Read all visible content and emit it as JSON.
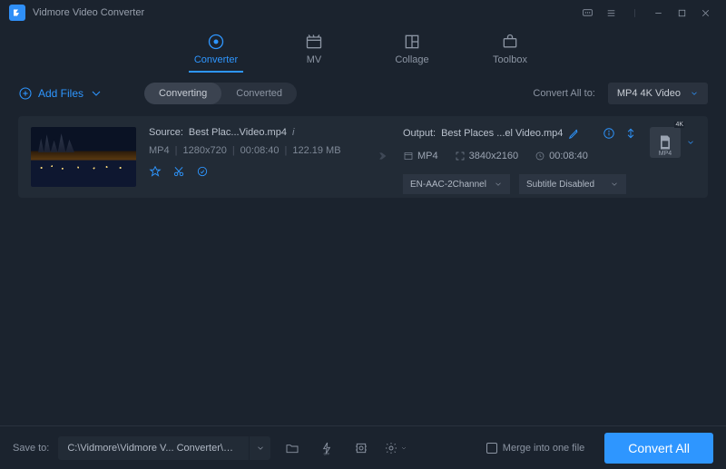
{
  "app": {
    "title": "Vidmore Video Converter"
  },
  "tabs": [
    {
      "label": "Converter",
      "active": true
    },
    {
      "label": "MV"
    },
    {
      "label": "Collage"
    },
    {
      "label": "Toolbox"
    }
  ],
  "toolbar": {
    "add_files": "Add Files",
    "seg": {
      "converting": "Converting",
      "converted": "Converted",
      "active": "converting"
    },
    "convert_all_to_label": "Convert All to:",
    "convert_all_to_value": "MP4 4K Video"
  },
  "item": {
    "source_label": "Source:",
    "source_name": "Best Plac...Video.mp4",
    "format": "MP4",
    "resolution": "1280x720",
    "duration": "00:08:40",
    "size": "122.19 MB",
    "output_label": "Output:",
    "output_name": "Best Places ...el Video.mp4",
    "out_format": "MP4",
    "out_resolution": "3840x2160",
    "out_duration": "00:08:40",
    "audio_sel": "EN-AAC-2Channel",
    "subtitle_sel": "Subtitle Disabled",
    "fmt_badge_top": "4K",
    "fmt_badge_label": "MP4"
  },
  "bottom": {
    "save_to_label": "Save to:",
    "save_to_path": "C:\\Vidmore\\Vidmore V... Converter\\Converted",
    "merge_label": "Merge into one file",
    "convert_all": "Convert All"
  }
}
